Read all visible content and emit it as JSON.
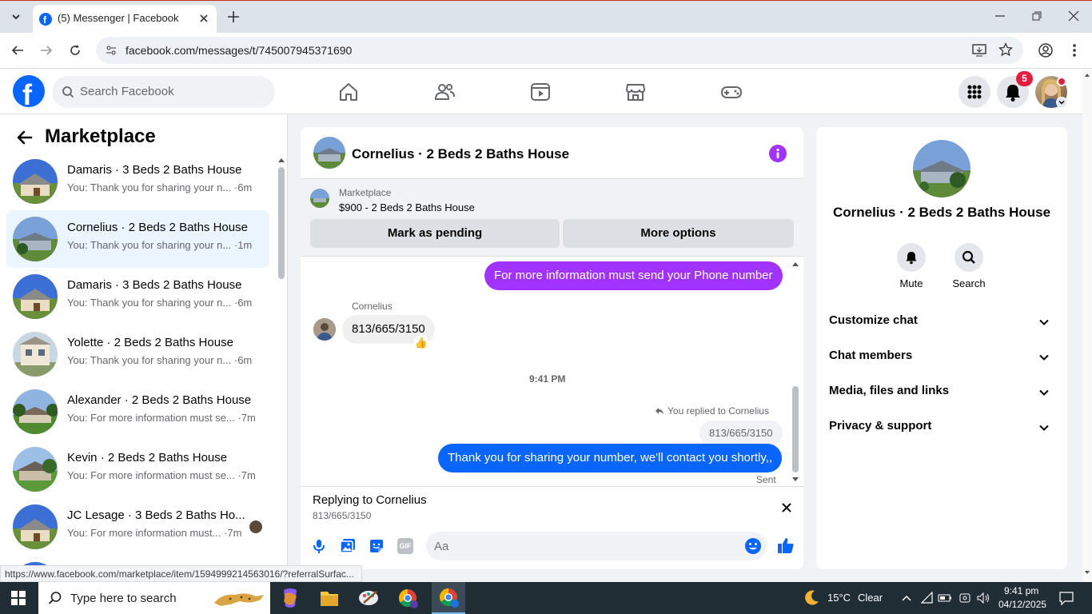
{
  "browser": {
    "tab_title": "(5) Messenger | Facebook",
    "url": "facebook.com/messages/t/745007945371690",
    "status_url": "https://www.facebook.com/marketplace/item/1594999214563016/?referralSurfac..."
  },
  "fb": {
    "search_placeholder": "Search Facebook",
    "notification_count": "5"
  },
  "left_panel": {
    "title": "Marketplace",
    "conversations": [
      {
        "name": "Damaris · 3 Beds 2 Baths House",
        "preview": "You: Thank you for sharing your n...",
        "time": "·6m"
      },
      {
        "name": "Cornelius · 2 Beds 2 Baths House",
        "preview": "You: Thank you for sharing your n...",
        "time": "·1m"
      },
      {
        "name": "Damaris · 3 Beds 2 Baths House",
        "preview": "You: Thank you for sharing your n...",
        "time": "·6m"
      },
      {
        "name": "Yolette · 2 Beds 2 Baths House",
        "preview": "You: Thank you for sharing your n...",
        "time": "·6m"
      },
      {
        "name": "Alexander · 2 Beds 2 Baths House",
        "preview": "You: For more information must se...",
        "time": "·7m"
      },
      {
        "name": "Kevin · 2 Beds 2 Baths House",
        "preview": "You: For more information must se...",
        "time": "·7m"
      },
      {
        "name": "JC Lesage · 3 Beds 2 Baths Ho...",
        "preview": "You: For more information must...",
        "time": "·7m"
      }
    ]
  },
  "chat": {
    "title": "Cornelius · 2 Beds 2 Baths House",
    "listing_source": "Marketplace",
    "listing_title": "$900 - 2 Beds 2 Baths House",
    "mark_pending": "Mark as pending",
    "more_options": "More options",
    "messages": {
      "outgoing_1": "For more information must send your Phone number",
      "sender_name": "Cornelius",
      "incoming_1": "813/665/3150",
      "reaction": "👍",
      "timestamp": "9:41 PM",
      "reply_note": "You replied to Cornelius",
      "quoted": "813/665/3150",
      "outgoing_2": "Thank you for sharing your number, we'll contact you shortly,,",
      "status": "Sent"
    },
    "replying_label": "Replying to Cornelius",
    "replying_quote": "813/665/3150",
    "composer_placeholder": "Aa",
    "gif_label": "GIF"
  },
  "right_panel": {
    "name": "Cornelius · 2 Beds 2 Baths House",
    "mute": "Mute",
    "search": "Search",
    "sections": [
      "Customize chat",
      "Chat members",
      "Media, files and links",
      "Privacy & support"
    ]
  },
  "taskbar": {
    "search_placeholder": "Type here to search",
    "weather_temp": "15°C",
    "weather_desc": "Clear",
    "time": "9:41 pm",
    "date": "04/12/2025"
  },
  "colors": {
    "fb_blue": "#0866ff",
    "messenger_purple": "#a033ff",
    "active_row": "#ebf5ff"
  }
}
